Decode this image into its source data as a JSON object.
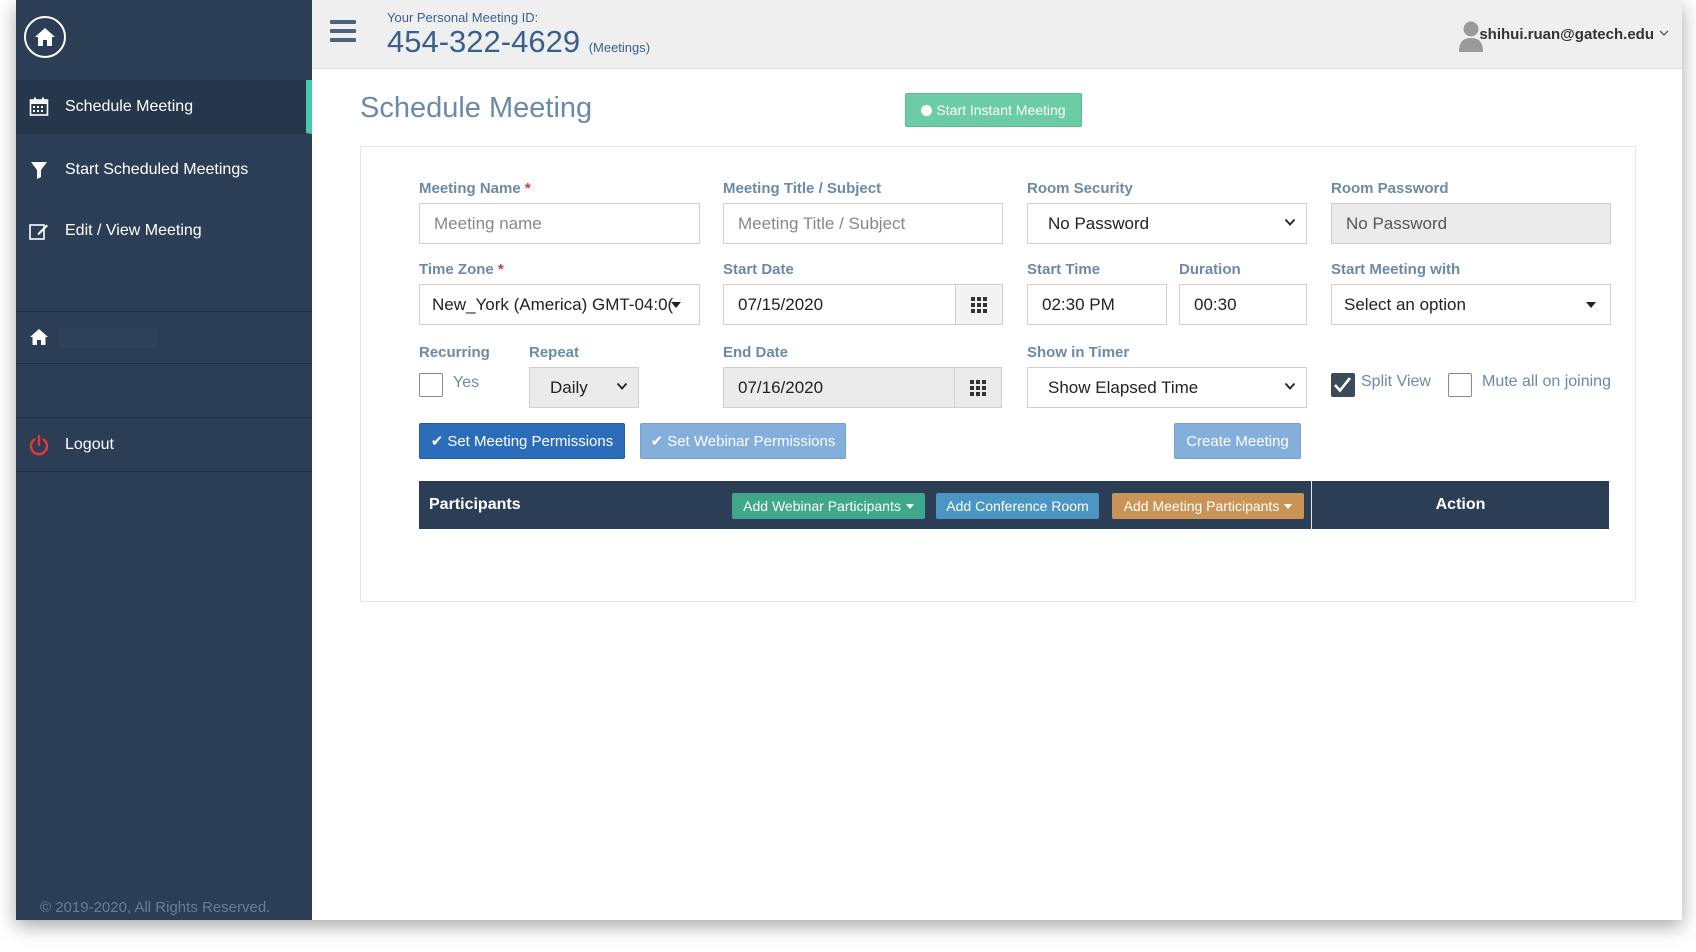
{
  "topbar": {
    "pmi_label": "Your Personal Meeting ID:",
    "pmi_number": "454-322-4629",
    "pmi_suffix": "(Meetings)",
    "user_email": "shihui.ruan@gatech.edu"
  },
  "sidebar": {
    "items": [
      {
        "label": "Schedule Meeting",
        "icon": "calendar-icon"
      },
      {
        "label": "Start Scheduled Meetings",
        "icon": "filter-icon"
      },
      {
        "label": "Edit / View Meeting",
        "icon": "edit-icon"
      }
    ],
    "logout_label": "Logout",
    "copyright": "© 2019-2020, All Rights Reserved."
  },
  "main": {
    "title": "Schedule Meeting",
    "instant_button": "Start Instant Meeting",
    "form": {
      "meeting_name_label": "Meeting Name",
      "meeting_name_placeholder": "Meeting name",
      "meeting_title_label": "Meeting Title / Subject",
      "meeting_title_placeholder": "Meeting Title / Subject",
      "room_security_label": "Room Security",
      "room_security_value": "No Password",
      "room_password_label": "Room Password",
      "room_password_value": "No Password",
      "time_zone_label": "Time Zone",
      "time_zone_value": "New_York (America) GMT-04:0(",
      "start_date_label": "Start Date",
      "start_date_value": "07/15/2020",
      "start_time_label": "Start Time",
      "start_time_value": "02:30 PM",
      "duration_label": "Duration",
      "duration_value": "00:30",
      "start_with_label": "Start Meeting with",
      "start_with_value": "Select an option",
      "recurring_label": "Recurring",
      "recurring_yes": "Yes",
      "repeat_label": "Repeat",
      "repeat_value": "Daily",
      "end_date_label": "End Date",
      "end_date_value": "07/16/2020",
      "show_timer_label": "Show in Timer",
      "show_timer_value": "Show Elapsed Time",
      "split_view_label": "Split View",
      "mute_label": "Mute all on joining"
    },
    "buttons": {
      "meeting_permissions": "Set Meeting Permissions",
      "webinar_permissions": "Set Webinar Permissions",
      "create_meeting": "Create Meeting"
    },
    "participants": {
      "header": "Participants",
      "add_webinar": "Add Webinar Participants",
      "add_conference": "Add Conference Room",
      "add_meeting": "Add Meeting Participants",
      "action": "Action"
    }
  },
  "colors": {
    "sidebar_bg": "#2c3e55",
    "accent_green": "#48c9a8",
    "primary_blue": "#2b6db8",
    "label_color": "#6b8aa8"
  }
}
